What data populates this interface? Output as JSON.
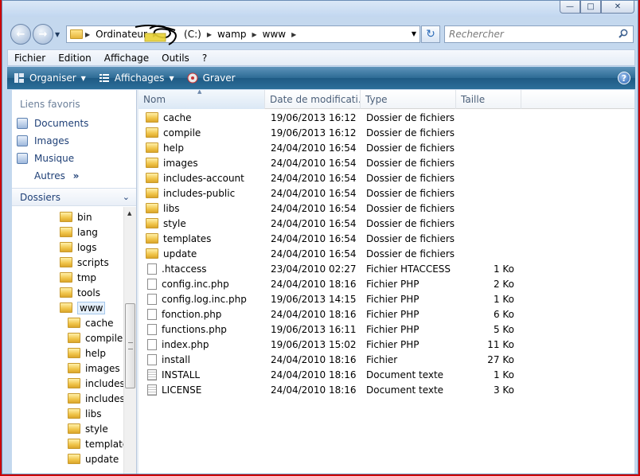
{
  "address": {
    "crumbs": [
      "Ordinateur",
      "(C:)",
      "wamp",
      "www"
    ]
  },
  "search": {
    "placeholder": "Rechercher"
  },
  "menu": [
    "Fichier",
    "Edition",
    "Affichage",
    "Outils",
    "?"
  ],
  "toolbar": {
    "organize": "Organiser",
    "views": "Affichages",
    "burn": "Graver",
    "help": "?"
  },
  "nav": {
    "favorites_title": "Liens favoris",
    "favorites": [
      "Documents",
      "Images",
      "Musique"
    ],
    "more": "Autres",
    "more_glyph": "»",
    "folders_title": "Dossiers"
  },
  "tree": [
    {
      "label": "bin",
      "level": 0
    },
    {
      "label": "lang",
      "level": 0
    },
    {
      "label": "logs",
      "level": 0
    },
    {
      "label": "scripts",
      "level": 0
    },
    {
      "label": "tmp",
      "level": 0
    },
    {
      "label": "tools",
      "level": 0
    },
    {
      "label": "www",
      "level": 0,
      "selected": true
    },
    {
      "label": "cache",
      "level": 1
    },
    {
      "label": "compile",
      "level": 1
    },
    {
      "label": "help",
      "level": 1
    },
    {
      "label": "images",
      "level": 1
    },
    {
      "label": "includes-",
      "level": 1
    },
    {
      "label": "includes-",
      "level": 1
    },
    {
      "label": "libs",
      "level": 1
    },
    {
      "label": "style",
      "level": 1
    },
    {
      "label": "template",
      "level": 1
    },
    {
      "label": "update",
      "level": 1
    }
  ],
  "columns": [
    "Nom",
    "Date de modificati...",
    "Type",
    "Taille"
  ],
  "files": [
    {
      "name": "cache",
      "date": "19/06/2013 16:12",
      "type": "Dossier de fichiers",
      "size": "",
      "kind": "folder"
    },
    {
      "name": "compile",
      "date": "19/06/2013 16:12",
      "type": "Dossier de fichiers",
      "size": "",
      "kind": "folder"
    },
    {
      "name": "help",
      "date": "24/04/2010 16:54",
      "type": "Dossier de fichiers",
      "size": "",
      "kind": "folder"
    },
    {
      "name": "images",
      "date": "24/04/2010 16:54",
      "type": "Dossier de fichiers",
      "size": "",
      "kind": "folder"
    },
    {
      "name": "includes-account",
      "date": "24/04/2010 16:54",
      "type": "Dossier de fichiers",
      "size": "",
      "kind": "folder"
    },
    {
      "name": "includes-public",
      "date": "24/04/2010 16:54",
      "type": "Dossier de fichiers",
      "size": "",
      "kind": "folder"
    },
    {
      "name": "libs",
      "date": "24/04/2010 16:54",
      "type": "Dossier de fichiers",
      "size": "",
      "kind": "folder"
    },
    {
      "name": "style",
      "date": "24/04/2010 16:54",
      "type": "Dossier de fichiers",
      "size": "",
      "kind": "folder"
    },
    {
      "name": "templates",
      "date": "24/04/2010 16:54",
      "type": "Dossier de fichiers",
      "size": "",
      "kind": "folder"
    },
    {
      "name": "update",
      "date": "24/04/2010 16:54",
      "type": "Dossier de fichiers",
      "size": "",
      "kind": "folder"
    },
    {
      "name": ".htaccess",
      "date": "23/04/2010 02:27",
      "type": "Fichier HTACCESS",
      "size": "1 Ko",
      "kind": "file"
    },
    {
      "name": "config.inc.php",
      "date": "24/04/2010 18:16",
      "type": "Fichier PHP",
      "size": "2 Ko",
      "kind": "file"
    },
    {
      "name": "config.log.inc.php",
      "date": "19/06/2013 14:15",
      "type": "Fichier PHP",
      "size": "1 Ko",
      "kind": "file"
    },
    {
      "name": "fonction.php",
      "date": "24/04/2010 18:16",
      "type": "Fichier PHP",
      "size": "6 Ko",
      "kind": "file"
    },
    {
      "name": "functions.php",
      "date": "19/06/2013 16:11",
      "type": "Fichier PHP",
      "size": "5 Ko",
      "kind": "file"
    },
    {
      "name": "index.php",
      "date": "19/06/2013 15:02",
      "type": "Fichier PHP",
      "size": "11 Ko",
      "kind": "file"
    },
    {
      "name": "install",
      "date": "24/04/2010 18:16",
      "type": "Fichier",
      "size": "27 Ko",
      "kind": "file"
    },
    {
      "name": "INSTALL",
      "date": "24/04/2010 18:16",
      "type": "Document texte",
      "size": "1 Ko",
      "kind": "txt"
    },
    {
      "name": "LICENSE",
      "date": "24/04/2010 18:16",
      "type": "Document texte",
      "size": "3 Ko",
      "kind": "txt"
    }
  ],
  "colors": {
    "accent": "#1e3f76",
    "toolbar": "#2d6b95",
    "frame": "#cc0000"
  }
}
